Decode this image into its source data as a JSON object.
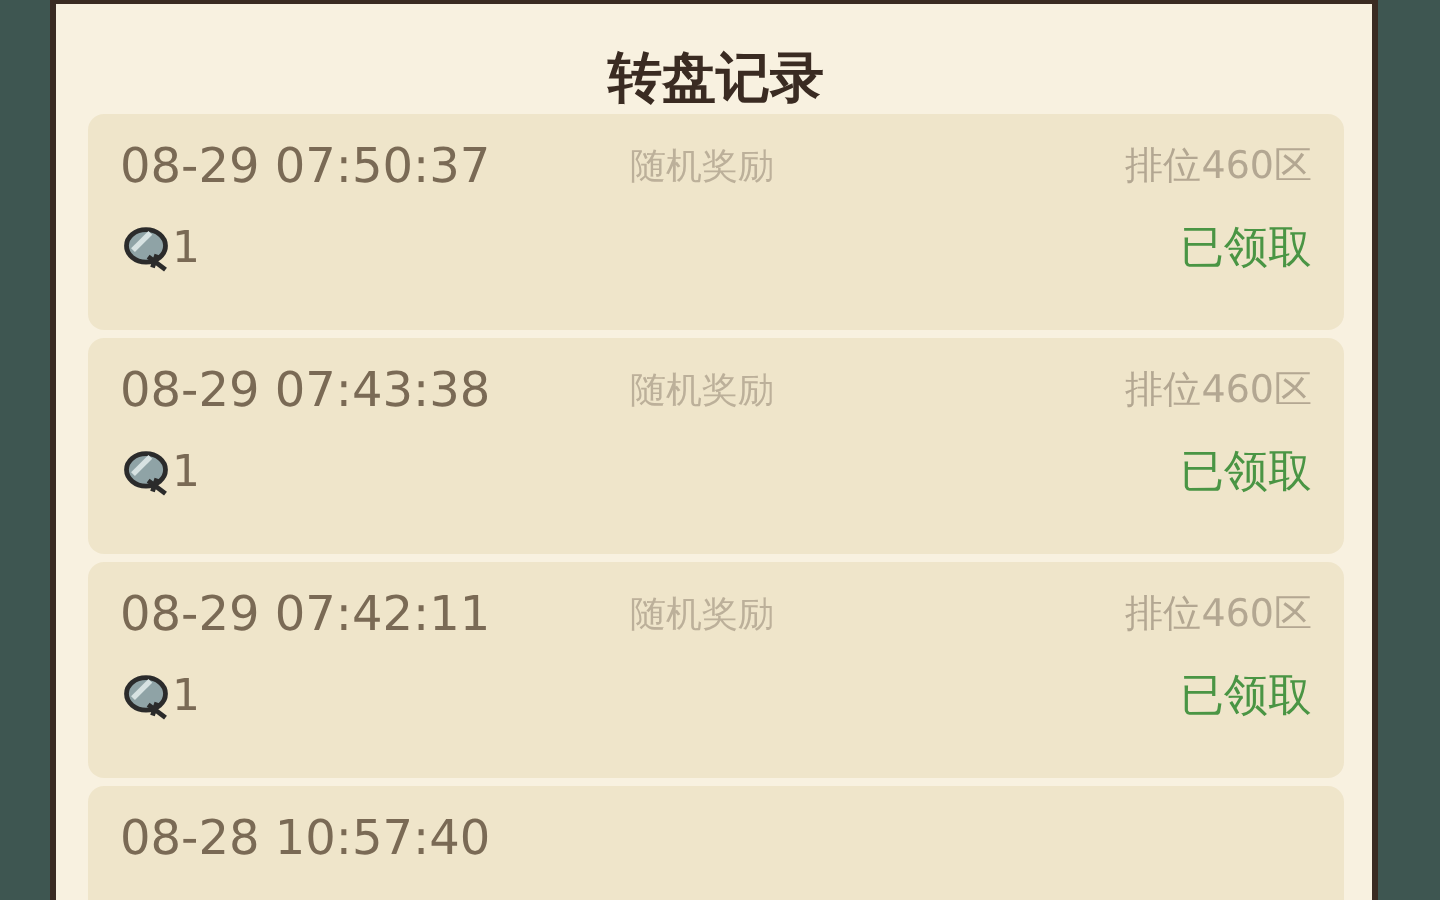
{
  "title": "转盘记录",
  "records": [
    {
      "time": "08-29 07:50:37",
      "source": "随机奖励",
      "zone": "排位460区",
      "amount": "1",
      "status": "已领取"
    },
    {
      "time": "08-29 07:43:38",
      "source": "随机奖励",
      "zone": "排位460区",
      "amount": "1",
      "status": "已领取"
    },
    {
      "time": "08-29 07:42:11",
      "source": "随机奖励",
      "zone": "排位460区",
      "amount": "1",
      "status": "已领取"
    },
    {
      "time": "08-28 10:57:40"
    }
  ]
}
